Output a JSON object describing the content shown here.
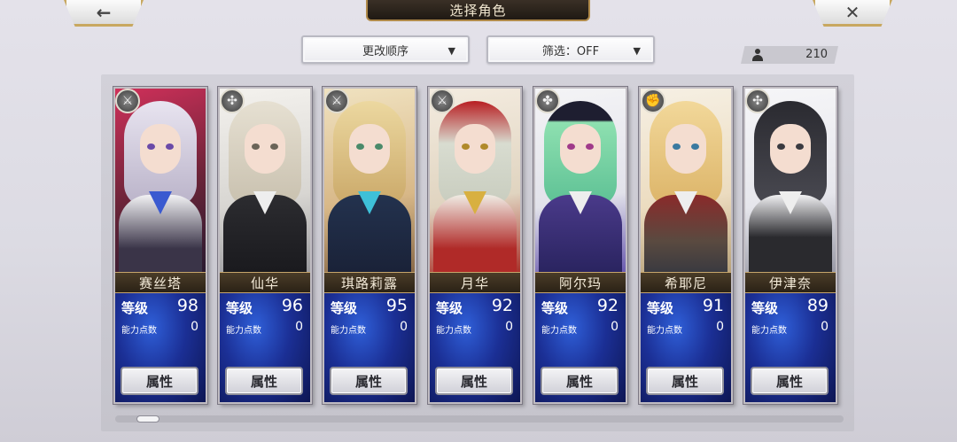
{
  "header": {
    "title": "选择角色",
    "back_icon": "←",
    "close_icon": "✕"
  },
  "controls": {
    "sort_label": "更改顺序",
    "filter_label": "筛选：OFF",
    "caret": "▼"
  },
  "user_count": "210",
  "attr_label": "属性",
  "characters": [
    {
      "name": "赛丝塔",
      "level_label": "等级",
      "level": "98",
      "points_label": "能力点数",
      "points": "0",
      "weapon_icon": "sword-icon",
      "weapon_glyph": "⚔"
    },
    {
      "name": "仙华",
      "level_label": "等级",
      "level": "96",
      "points_label": "能力点数",
      "points": "0",
      "weapon_icon": "staff-icon",
      "weapon_glyph": "✣"
    },
    {
      "name": "琪路莉露",
      "level_label": "等级",
      "level": "95",
      "points_label": "能力点数",
      "points": "0",
      "weapon_icon": "sword-icon",
      "weapon_glyph": "⚔"
    },
    {
      "name": "月华",
      "level_label": "等级",
      "level": "92",
      "points_label": "能力点数",
      "points": "0",
      "weapon_icon": "blade-icon",
      "weapon_glyph": "⚔"
    },
    {
      "name": "阿尔玛",
      "level_label": "等级",
      "level": "92",
      "points_label": "能力点数",
      "points": "0",
      "weapon_icon": "spear-icon",
      "weapon_glyph": "✤"
    },
    {
      "name": "希耶尼",
      "level_label": "等级",
      "level": "91",
      "points_label": "能力点数",
      "points": "0",
      "weapon_icon": "fist-icon",
      "weapon_glyph": "✊"
    },
    {
      "name": "伊津奈",
      "level_label": "等级",
      "level": "89",
      "points_label": "能力点数",
      "points": "0",
      "weapon_icon": "staff-icon",
      "weapon_glyph": "✣"
    }
  ],
  "colors": {
    "card_frame": "#c0bcc2",
    "stats_blue": "#1b2f95",
    "name_plate": "#2b2216",
    "title_text": "#f1e7d0"
  }
}
